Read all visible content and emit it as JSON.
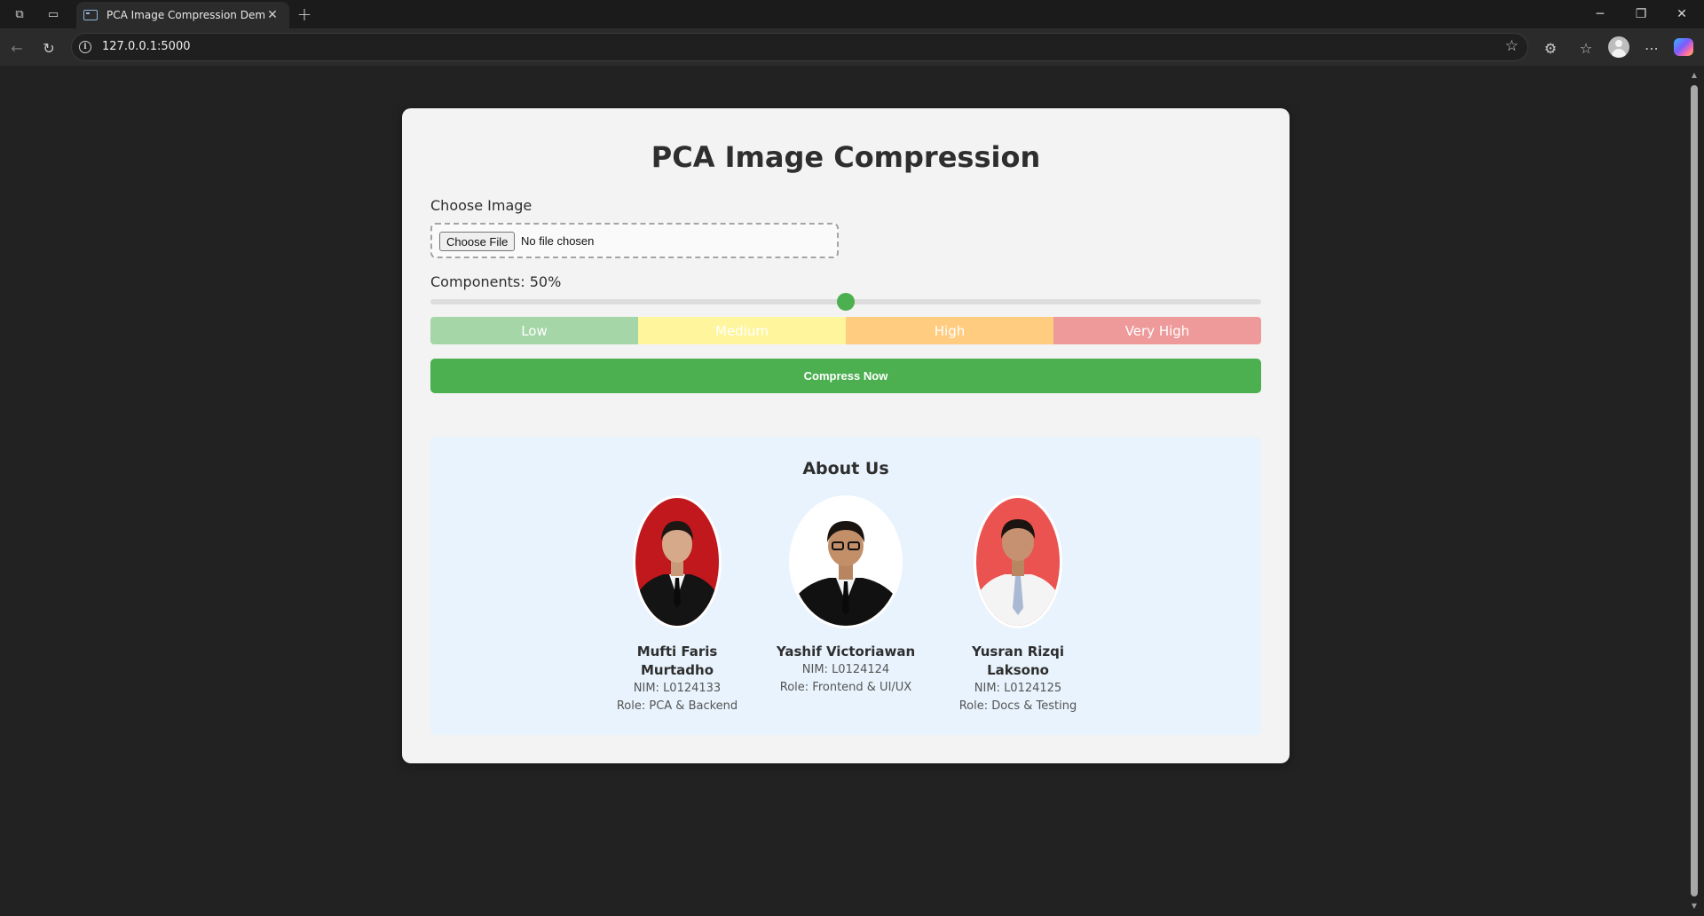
{
  "browser": {
    "tab_title": "PCA Image Compression Demo",
    "url": "127.0.0.1:5000"
  },
  "page": {
    "title": "PCA Image Compression",
    "choose_image_label": "Choose Image",
    "file_button_label": "Choose File",
    "file_status": "No file chosen",
    "components_label": "Components: 50%",
    "components_value_percent": 50,
    "levels": [
      "Low",
      "Medium",
      "High",
      "Very High"
    ],
    "compress_button": "Compress Now"
  },
  "about": {
    "title": "About Us",
    "members": [
      {
        "name": "Mufti Faris Murtadho",
        "nim": "NIM: L0124133",
        "role": "Role: PCA & Backend",
        "photo_bg": "#c0181d"
      },
      {
        "name": "Yashif Victoriawan",
        "nim": "NIM: L0124124",
        "role": "Role: Frontend & UI/UX",
        "photo_bg": "#ffffff"
      },
      {
        "name": "Yusran Rizqi Laksono",
        "nim": "NIM: L0124125",
        "role": "Role: Docs & Testing",
        "photo_bg": "#ea5350"
      }
    ]
  },
  "colors": {
    "accent": "#4caf50",
    "level_low": "#a5d6a7",
    "level_medium": "#fff59d",
    "level_high": "#ffcc80",
    "level_very_high": "#ef9a9a"
  }
}
